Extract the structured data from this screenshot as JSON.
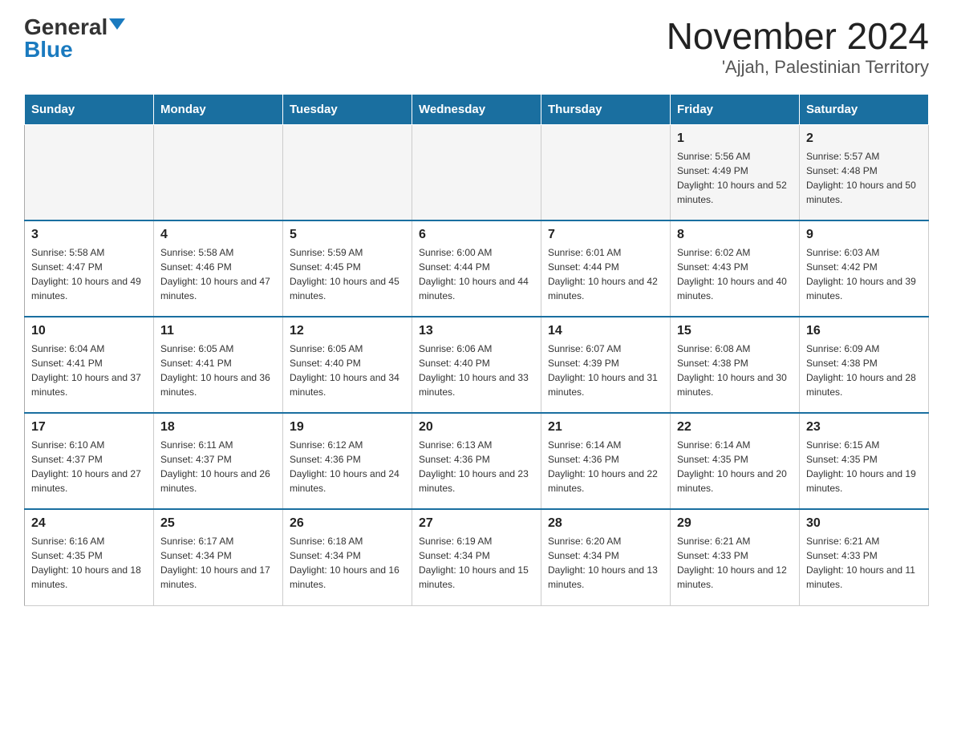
{
  "logo": {
    "general": "General",
    "blue": "Blue"
  },
  "title": "November 2024",
  "subtitle": "'Ajjah, Palestinian Territory",
  "days": {
    "headers": [
      "Sunday",
      "Monday",
      "Tuesday",
      "Wednesday",
      "Thursday",
      "Friday",
      "Saturday"
    ]
  },
  "weeks": [
    {
      "cells": [
        {
          "day": "",
          "info": ""
        },
        {
          "day": "",
          "info": ""
        },
        {
          "day": "",
          "info": ""
        },
        {
          "day": "",
          "info": ""
        },
        {
          "day": "",
          "info": ""
        },
        {
          "day": "1",
          "info": "Sunrise: 5:56 AM\nSunset: 4:49 PM\nDaylight: 10 hours and 52 minutes."
        },
        {
          "day": "2",
          "info": "Sunrise: 5:57 AM\nSunset: 4:48 PM\nDaylight: 10 hours and 50 minutes."
        }
      ]
    },
    {
      "cells": [
        {
          "day": "3",
          "info": "Sunrise: 5:58 AM\nSunset: 4:47 PM\nDaylight: 10 hours and 49 minutes."
        },
        {
          "day": "4",
          "info": "Sunrise: 5:58 AM\nSunset: 4:46 PM\nDaylight: 10 hours and 47 minutes."
        },
        {
          "day": "5",
          "info": "Sunrise: 5:59 AM\nSunset: 4:45 PM\nDaylight: 10 hours and 45 minutes."
        },
        {
          "day": "6",
          "info": "Sunrise: 6:00 AM\nSunset: 4:44 PM\nDaylight: 10 hours and 44 minutes."
        },
        {
          "day": "7",
          "info": "Sunrise: 6:01 AM\nSunset: 4:44 PM\nDaylight: 10 hours and 42 minutes."
        },
        {
          "day": "8",
          "info": "Sunrise: 6:02 AM\nSunset: 4:43 PM\nDaylight: 10 hours and 40 minutes."
        },
        {
          "day": "9",
          "info": "Sunrise: 6:03 AM\nSunset: 4:42 PM\nDaylight: 10 hours and 39 minutes."
        }
      ]
    },
    {
      "cells": [
        {
          "day": "10",
          "info": "Sunrise: 6:04 AM\nSunset: 4:41 PM\nDaylight: 10 hours and 37 minutes."
        },
        {
          "day": "11",
          "info": "Sunrise: 6:05 AM\nSunset: 4:41 PM\nDaylight: 10 hours and 36 minutes."
        },
        {
          "day": "12",
          "info": "Sunrise: 6:05 AM\nSunset: 4:40 PM\nDaylight: 10 hours and 34 minutes."
        },
        {
          "day": "13",
          "info": "Sunrise: 6:06 AM\nSunset: 4:40 PM\nDaylight: 10 hours and 33 minutes."
        },
        {
          "day": "14",
          "info": "Sunrise: 6:07 AM\nSunset: 4:39 PM\nDaylight: 10 hours and 31 minutes."
        },
        {
          "day": "15",
          "info": "Sunrise: 6:08 AM\nSunset: 4:38 PM\nDaylight: 10 hours and 30 minutes."
        },
        {
          "day": "16",
          "info": "Sunrise: 6:09 AM\nSunset: 4:38 PM\nDaylight: 10 hours and 28 minutes."
        }
      ]
    },
    {
      "cells": [
        {
          "day": "17",
          "info": "Sunrise: 6:10 AM\nSunset: 4:37 PM\nDaylight: 10 hours and 27 minutes."
        },
        {
          "day": "18",
          "info": "Sunrise: 6:11 AM\nSunset: 4:37 PM\nDaylight: 10 hours and 26 minutes."
        },
        {
          "day": "19",
          "info": "Sunrise: 6:12 AM\nSunset: 4:36 PM\nDaylight: 10 hours and 24 minutes."
        },
        {
          "day": "20",
          "info": "Sunrise: 6:13 AM\nSunset: 4:36 PM\nDaylight: 10 hours and 23 minutes."
        },
        {
          "day": "21",
          "info": "Sunrise: 6:14 AM\nSunset: 4:36 PM\nDaylight: 10 hours and 22 minutes."
        },
        {
          "day": "22",
          "info": "Sunrise: 6:14 AM\nSunset: 4:35 PM\nDaylight: 10 hours and 20 minutes."
        },
        {
          "day": "23",
          "info": "Sunrise: 6:15 AM\nSunset: 4:35 PM\nDaylight: 10 hours and 19 minutes."
        }
      ]
    },
    {
      "cells": [
        {
          "day": "24",
          "info": "Sunrise: 6:16 AM\nSunset: 4:35 PM\nDaylight: 10 hours and 18 minutes."
        },
        {
          "day": "25",
          "info": "Sunrise: 6:17 AM\nSunset: 4:34 PM\nDaylight: 10 hours and 17 minutes."
        },
        {
          "day": "26",
          "info": "Sunrise: 6:18 AM\nSunset: 4:34 PM\nDaylight: 10 hours and 16 minutes."
        },
        {
          "day": "27",
          "info": "Sunrise: 6:19 AM\nSunset: 4:34 PM\nDaylight: 10 hours and 15 minutes."
        },
        {
          "day": "28",
          "info": "Sunrise: 6:20 AM\nSunset: 4:34 PM\nDaylight: 10 hours and 13 minutes."
        },
        {
          "day": "29",
          "info": "Sunrise: 6:21 AM\nSunset: 4:33 PM\nDaylight: 10 hours and 12 minutes."
        },
        {
          "day": "30",
          "info": "Sunrise: 6:21 AM\nSunset: 4:33 PM\nDaylight: 10 hours and 11 minutes."
        }
      ]
    }
  ]
}
